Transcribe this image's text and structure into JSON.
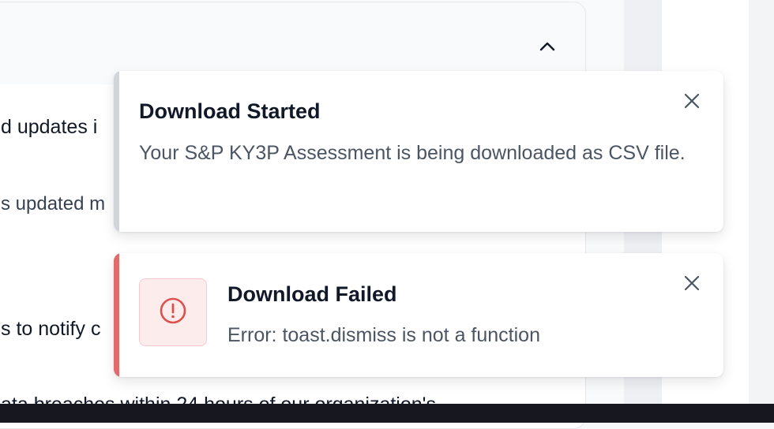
{
  "background": {
    "content_lines": [
      "d updates i",
      "s updated m",
      "s to notify c",
      "ata breaches within 24 hours of our organization's"
    ]
  },
  "toasts": {
    "started": {
      "title": "Download Started",
      "body": "Your S&P KY3P Assessment is being downloaded as CSV file.",
      "close_icon": "close-icon"
    },
    "failed": {
      "title": "Download Failed",
      "body": "Error: toast.dismiss is not a function",
      "icon": "alert-circle-icon",
      "close_icon": "close-icon"
    }
  },
  "colors": {
    "failed_accent": "#e06b6b",
    "started_accent": "#d1d5db",
    "error_icon": "#dc5050"
  }
}
